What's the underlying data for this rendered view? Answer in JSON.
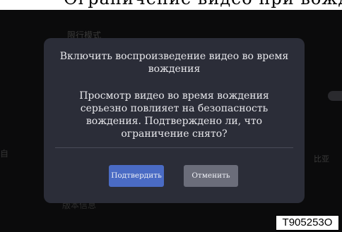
{
  "background": {
    "top_cut_text": "Ограничение видео при вождении",
    "item_label_1": "限行模式",
    "item_label_2": "版本信息",
    "side_left_glyph": "自",
    "side_right_label": "比亚"
  },
  "dialog": {
    "title": "Включить воспроизведение видео во время вождения",
    "message": "Просмотр видео во время вождения серьезно повлияет на безопасность вождения. Подтверждено ли, что ограничение снято?",
    "confirm_label": "Подтвердить",
    "cancel_label": "Отменить"
  },
  "figure_id": "T905253O",
  "colors": {
    "dialog_bg": "#2b2d38",
    "confirm_bg": "#4a6bc4",
    "cancel_bg": "#6b6d7a",
    "screen_bg": "#0b0b0c"
  }
}
